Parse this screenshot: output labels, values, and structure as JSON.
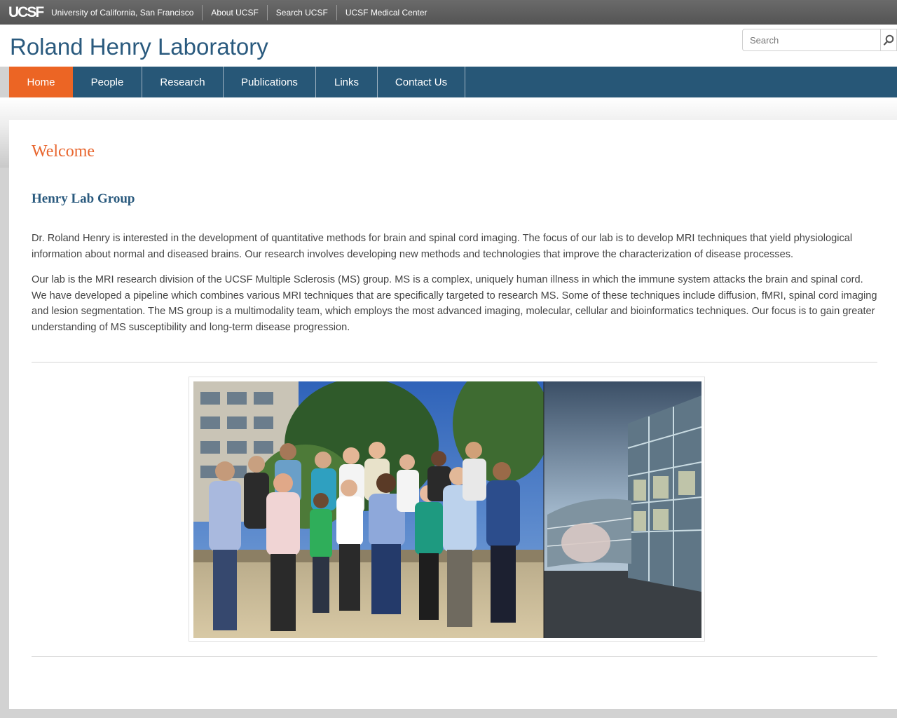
{
  "topbar": {
    "logo": "UCSF",
    "links": [
      "University of California, San Francisco",
      "About UCSF",
      "Search UCSF",
      "UCSF Medical Center"
    ]
  },
  "header": {
    "site_title": "Roland Henry Laboratory",
    "search_placeholder": "Search",
    "search_icon": "magnifier-icon"
  },
  "nav": {
    "items": [
      {
        "label": "Home",
        "active": true
      },
      {
        "label": "People",
        "active": false
      },
      {
        "label": "Research",
        "active": false
      },
      {
        "label": "Publications",
        "active": false
      },
      {
        "label": "Links",
        "active": false
      },
      {
        "label": "Contact Us",
        "active": false
      }
    ]
  },
  "main": {
    "heading": "Welcome",
    "subheading": "Henry Lab Group",
    "paragraphs": [
      "Dr. Roland Henry is interested in the development of quantitative methods for brain and spinal cord imaging. The focus of our lab is to develop MRI techniques that yield physiological information about normal and diseased brains. Our research involves developing new methods and technologies that improve the characterization of disease processes.",
      "Our lab is the MRI research division of the UCSF Multiple Sclerosis (MS) group. MS is a complex, uniquely human illness in which the immune system attacks the brain and spinal cord. We have developed a pipeline which combines various MRI techniques that are specifically targeted to research MS. Some of these techniques include diffusion, fMRI, spinal cord imaging and lesion segmentation. The MS group is a multimodality team, which employs the most advanced imaging, molecular, cellular and bioinformatics techniques. Our focus is to gain greater understanding of MS susceptibility and long-term disease progression."
    ]
  },
  "colors": {
    "accent_orange": "#ec6524",
    "nav_blue": "#275777",
    "title_blue": "#2a5a7e",
    "topbar_gray": "#5e5e5e"
  }
}
